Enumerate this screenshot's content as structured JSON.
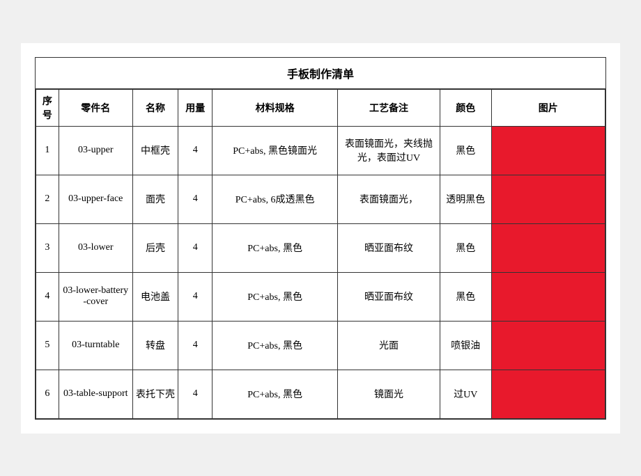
{
  "title": "手板制作清单",
  "headers": {
    "seq": "序号",
    "part": "零件名",
    "name": "名称",
    "qty": "用量",
    "spec": "材料规格",
    "process": "工艺备注",
    "color": "颜色",
    "pic": "图片"
  },
  "rows": [
    {
      "seq": "1",
      "part": "03-upper",
      "name": "中框壳",
      "qty": "4",
      "spec": "PC+abs, 黑色镜面光",
      "process": "表面镜面光，夹线抛光，表面过UV",
      "color": "黑色"
    },
    {
      "seq": "2",
      "part": "03-upper-face",
      "name": "面壳",
      "qty": "4",
      "spec": "PC+abs, 6成透黑色",
      "process": "表面镜面光，",
      "color": "透明黑色"
    },
    {
      "seq": "3",
      "part": "03-lower",
      "name": "后壳",
      "qty": "4",
      "spec": "PC+abs, 黑色",
      "process": "晒亚面布纹",
      "color": "黑色"
    },
    {
      "seq": "4",
      "part": "03-lower-battery-cover",
      "name": "电池盖",
      "qty": "4",
      "spec": "PC+abs, 黑色",
      "process": "晒亚面布纹",
      "color": "黑色"
    },
    {
      "seq": "5",
      "part": "03-turntable",
      "name": "转盘",
      "qty": "4",
      "spec": "PC+abs, 黑色",
      "process": "光面",
      "color": "喷银油"
    },
    {
      "seq": "6",
      "part": "03-table-support",
      "name": "表托下壳",
      "qty": "4",
      "spec": "PC+abs, 黑色",
      "process": "镜面光",
      "color": "过UV"
    }
  ]
}
